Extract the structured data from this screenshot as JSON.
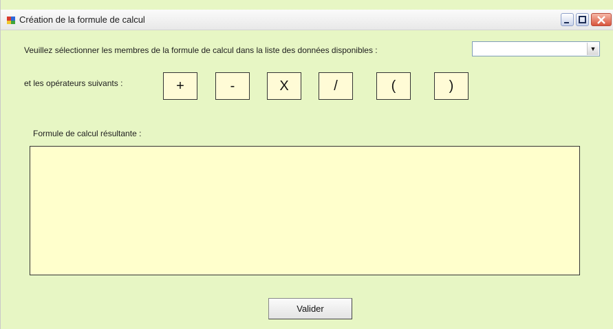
{
  "window": {
    "title": "Création de la formule de calcul",
    "accent": "#e7f6c4"
  },
  "form": {
    "select_label": "Veuillez sélectionner les membres de la formule de calcul dans la liste des données disponibles :",
    "select_value": "",
    "operators_label": "et les opérateurs suivants :",
    "operators": [
      "+",
      "-",
      "X",
      "/",
      "(",
      ")"
    ],
    "result_label": "Formule de calcul résultante :",
    "result_value": "",
    "submit_label": "Valider"
  }
}
